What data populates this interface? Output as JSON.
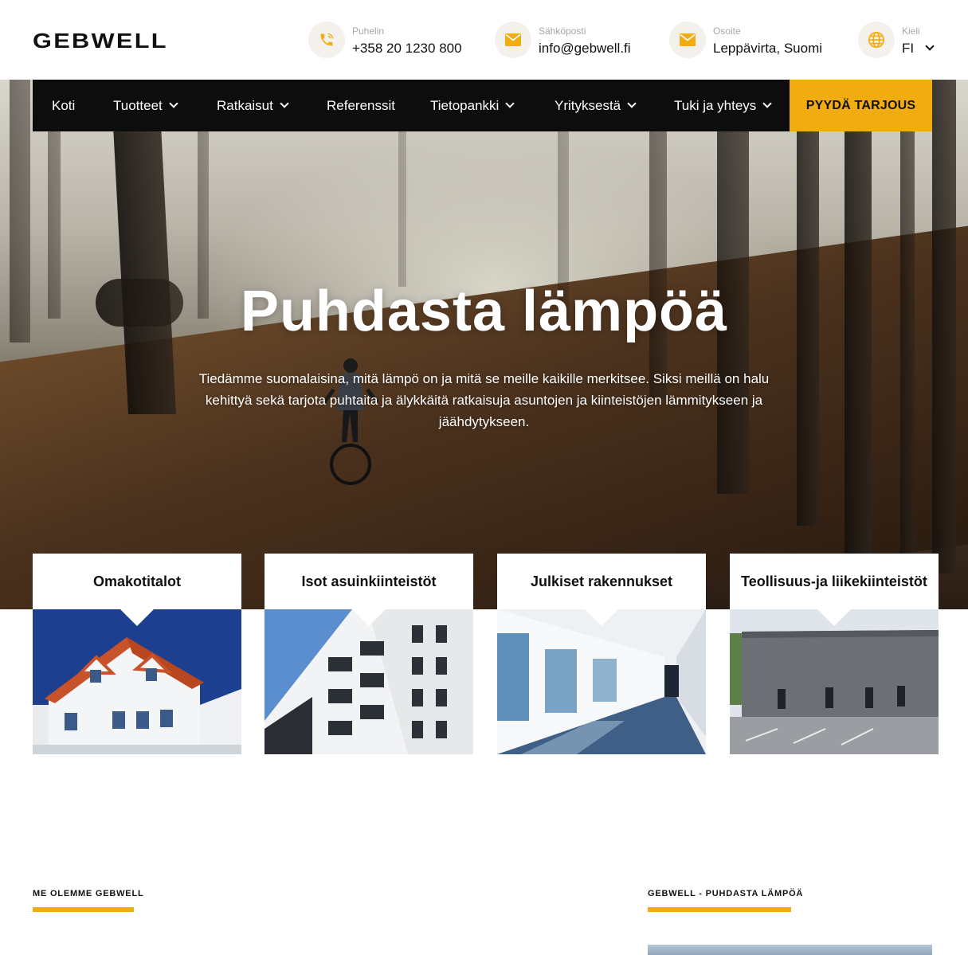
{
  "header": {
    "logo_text": "GEBWELL",
    "phone": {
      "label": "Puhelin",
      "value": "+358 20 1230 800",
      "icon": "phone-icon"
    },
    "email": {
      "label": "Sähköposti",
      "value": "info@gebwell.fi",
      "icon": "mail-icon"
    },
    "address": {
      "label": "Osoite",
      "value": "Leppävirta, Suomi",
      "icon": "mail-icon"
    },
    "language": {
      "label": "Kieli",
      "value": "FI",
      "icon": "globe-icon"
    }
  },
  "nav": {
    "items": [
      {
        "label": "Koti",
        "dropdown": false
      },
      {
        "label": "Tuotteet",
        "dropdown": true
      },
      {
        "label": "Ratkaisut",
        "dropdown": true
      },
      {
        "label": "Referenssit",
        "dropdown": false
      },
      {
        "label": "Tietopankki",
        "dropdown": true
      },
      {
        "label": "Yrityksestä",
        "dropdown": true
      },
      {
        "label": "Tuki ja yhteys",
        "dropdown": true
      }
    ],
    "cta_label": "PYYDÄ TARJOUS"
  },
  "hero": {
    "title": "Puhdasta lämpöä",
    "text": "Tiedämme suomalaisina, mitä lämpö on ja mitä se meille kaikille merkitsee. Siksi meillä on halu kehittyä sekä tarjota puhtaita ja älykkäitä ratkaisuja asuntojen ja kiinteistöjen lämmitykseen ja jäähdytykseen."
  },
  "cards": [
    {
      "title": "Omakotitalot"
    },
    {
      "title": "Isot asuinkiinteistöt"
    },
    {
      "title": "Julkiset rakennukset"
    },
    {
      "title": "Teollisuus-ja liikekiinteistöt"
    }
  ],
  "sections": {
    "left_eyebrow": "ME OLEMME GEBWELL",
    "right_eyebrow": "GEBWELL - PUHDASTA LÄMPÖÄ"
  },
  "colors": {
    "accent": "#f1ac12",
    "nav_bg": "#0d0d0d",
    "icon_bg": "#f4f1ec"
  }
}
